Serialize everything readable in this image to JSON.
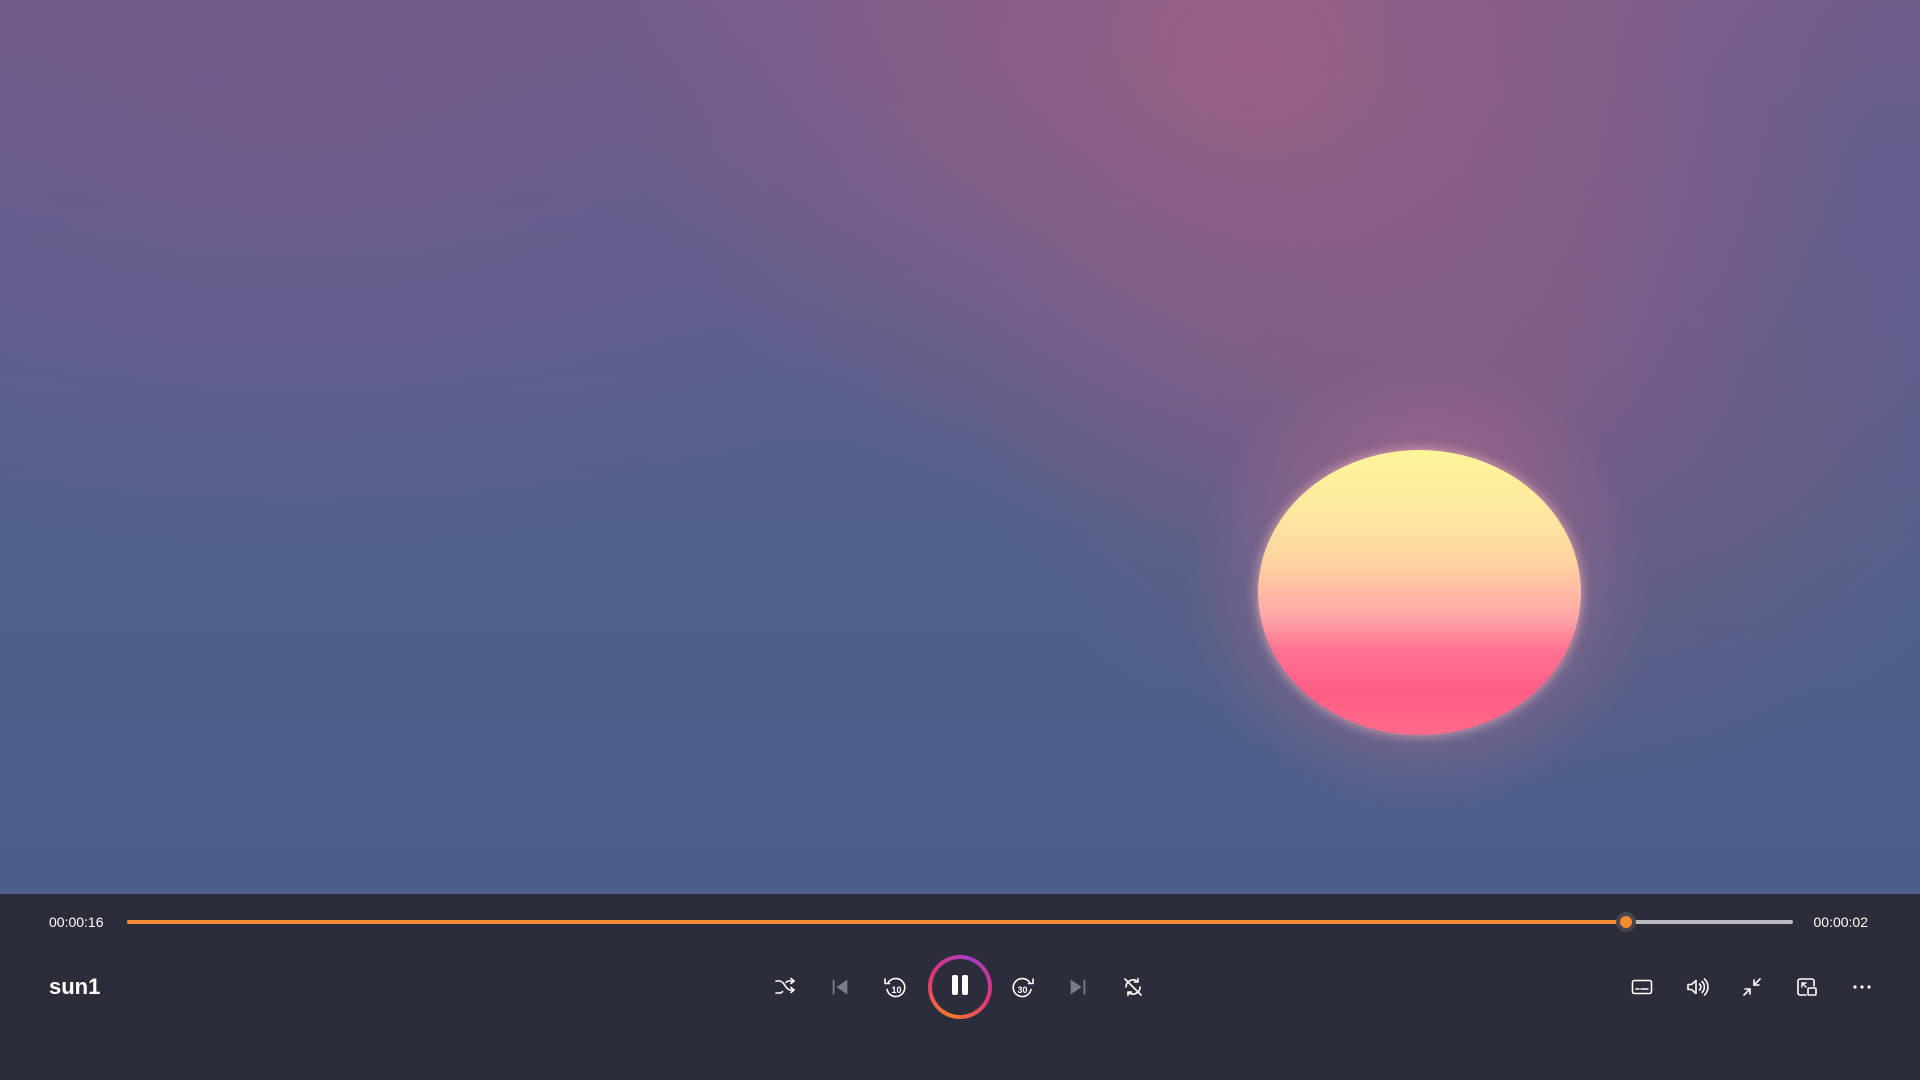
{
  "video": {
    "title": "sun1",
    "scene_icon": "sunset-scene"
  },
  "playback": {
    "elapsed": "00:00:16",
    "remaining": "00:00:02",
    "progress_fraction": 0.9
  },
  "colors": {
    "accent": "#f28a30",
    "control_bar": "#2b2d3a",
    "play_ring_start": "#f47a2a",
    "play_ring_mid": "#e0357c",
    "play_ring_end": "#a63ec4"
  },
  "controls": {
    "center": [
      {
        "name": "shuffle-icon",
        "state": "off"
      },
      {
        "name": "previous-track-icon",
        "state": "disabled"
      },
      {
        "name": "skip-back-10-icon",
        "seconds": "10"
      },
      {
        "name": "pause-icon",
        "state": "playing"
      },
      {
        "name": "skip-forward-30-icon",
        "seconds": "30"
      },
      {
        "name": "next-track-icon",
        "state": "disabled"
      },
      {
        "name": "repeat-icon",
        "state": "off"
      }
    ],
    "right": [
      {
        "name": "subtitles-icon"
      },
      {
        "name": "volume-icon"
      },
      {
        "name": "exit-fullscreen-icon"
      },
      {
        "name": "mini-player-icon"
      },
      {
        "name": "more-options-icon"
      }
    ]
  }
}
